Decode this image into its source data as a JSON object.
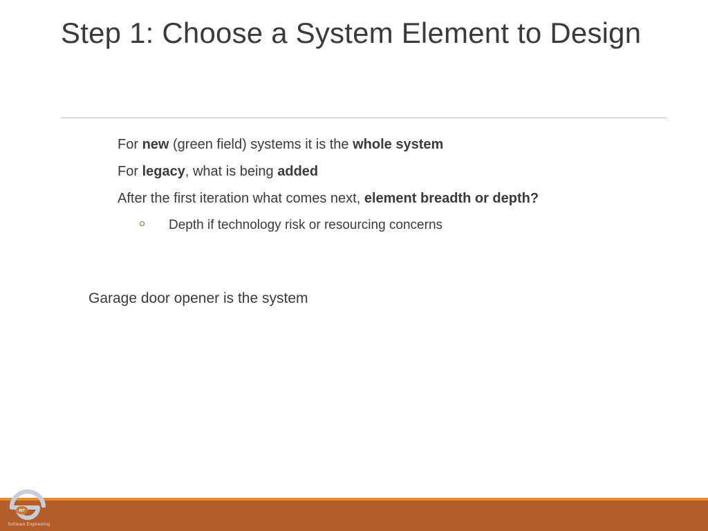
{
  "title": "Step 1: Choose a System Element to Design",
  "bullets": {
    "b1_pre": "For ",
    "b1_bold1": "new",
    "b1_mid": " (green field) systems it is the ",
    "b1_bold2": "whole system",
    "b2_pre": "For ",
    "b2_bold1": "legacy",
    "b2_mid": ", what is being ",
    "b2_bold2": "added",
    "b3_pre": "After the first iteration what comes next, ",
    "b3_bold": "element breadth or depth?",
    "sub1": "Depth if technology risk or resourcing concerns"
  },
  "closing": "Garage door opener is the system",
  "logo": {
    "badge": "RIT",
    "caption": "Software Engineering"
  },
  "colors": {
    "accent_light": "#e78a2e",
    "accent_dark": "#b45d28",
    "ring": "#a25d29",
    "logo_ring": "#c6cede",
    "logo_badge": "#d0792e"
  }
}
